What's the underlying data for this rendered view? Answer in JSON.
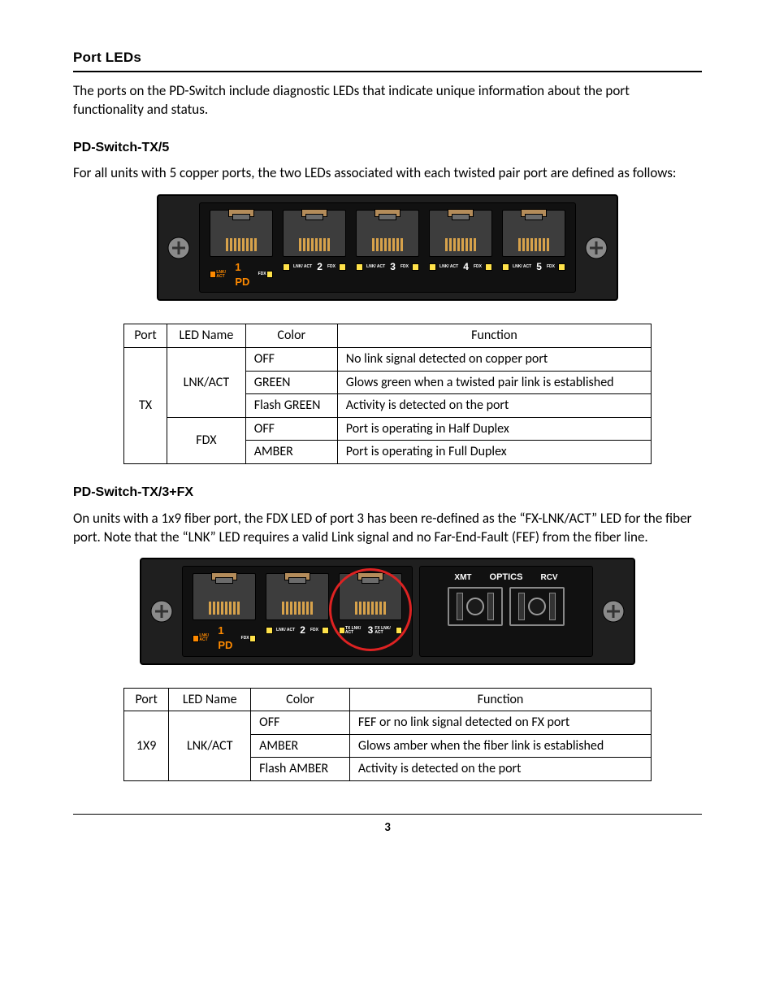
{
  "page_number": "3",
  "section_title": "Port LEDs",
  "intro_paragraph": "The ports on the PD-Switch include diagnostic LEDs that indicate unique information about the port functionality and status.",
  "tx5": {
    "heading": "PD-Switch-TX/5",
    "paragraph": "For all units with 5 copper ports, the two LEDs associated with each twisted pair port are defined as follows:",
    "figure": {
      "ports": [
        {
          "number": "1 PD",
          "left_label": "LNK/\nACT",
          "right_label": "FDX",
          "pd": true
        },
        {
          "number": "2",
          "left_label": "LNK/\nACT",
          "right_label": "FDX",
          "pd": false
        },
        {
          "number": "3",
          "left_label": "LNK/\nACT",
          "right_label": "FDX",
          "pd": false
        },
        {
          "number": "4",
          "left_label": "LNK/\nACT",
          "right_label": "FDX",
          "pd": false
        },
        {
          "number": "5",
          "left_label": "LNK/\nACT",
          "right_label": "FDX",
          "pd": false
        }
      ]
    },
    "table": {
      "headers": {
        "port": "Port",
        "led": "LED Name",
        "color": "Color",
        "function": "Function"
      },
      "port_label": "TX",
      "rows": [
        {
          "led": "LNK/ACT",
          "color": "OFF",
          "function": "No link signal detected on copper port",
          "led_rowspan": 3
        },
        {
          "led": "",
          "color": "GREEN",
          "function": "Glows green when a twisted pair link is established"
        },
        {
          "led": "",
          "color": "Flash GREEN",
          "function": "Activity is detected on the port"
        },
        {
          "led": "FDX",
          "color": "OFF",
          "function": "Port is operating in Half Duplex",
          "led_rowspan": 2
        },
        {
          "led": "",
          "color": "AMBER",
          "function": "Port is operating in Full Duplex"
        }
      ]
    }
  },
  "tx3fx": {
    "heading": "PD-Switch-TX/3+FX",
    "paragraph": "On units with a 1x9 fiber port, the FDX LED of port 3 has been re-defined as the “FX-LNK/ACT” LED for the fiber port.  Note that the “LNK” LED requires a valid Link signal and no Far-End-Fault (FEF) from the fiber line.",
    "figure": {
      "ports": [
        {
          "number": "1 PD",
          "left_label": "LNK/\nACT",
          "right_label": "FDX",
          "pd": true
        },
        {
          "number": "2",
          "left_label": "LNK/\nACT",
          "right_label": "FDX",
          "pd": false
        },
        {
          "number": "3",
          "left_label": "TX LNK/\nACT",
          "right_label": "FX LNK/\nACT",
          "pd": false,
          "circled": true
        }
      ],
      "optics": {
        "left": "XMT",
        "center": "OPTICS",
        "right": "RCV"
      }
    },
    "table": {
      "headers": {
        "port": "Port",
        "led": "LED Name",
        "color": "Color",
        "function": "Function"
      },
      "port_label": "1X9",
      "rows": [
        {
          "led": "LNK/ACT",
          "color": "OFF",
          "function": "FEF or no link signal detected on FX port",
          "led_rowspan": 3
        },
        {
          "led": "",
          "color": "AMBER",
          "function": "Glows amber when the fiber link is established"
        },
        {
          "led": "",
          "color": "Flash AMBER",
          "function": "Activity is detected on the port"
        }
      ]
    }
  }
}
